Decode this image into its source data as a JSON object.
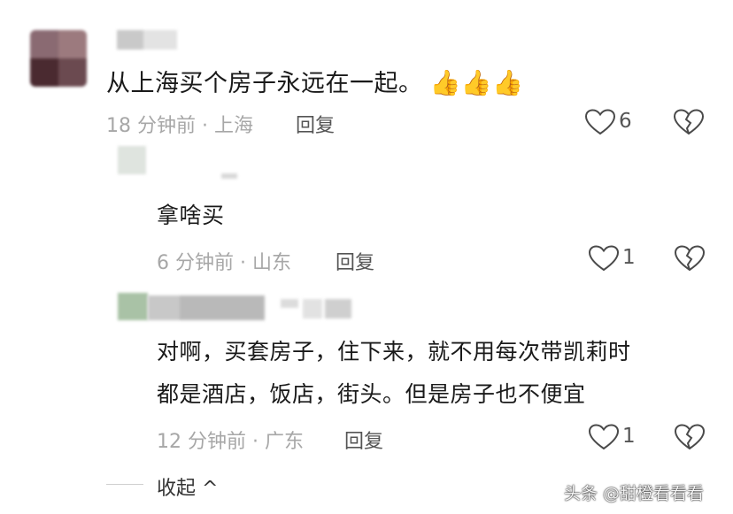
{
  "comments": [
    {
      "text": "从上海买个房子永远在一起。",
      "emoji": "👍👍👍",
      "meta": "18 分钟前 · 上海",
      "reply_label": "回复",
      "likes": "6"
    },
    {
      "text": "拿啥买",
      "meta": "6 分钟前 · 山东",
      "reply_label": "回复",
      "likes": "1"
    },
    {
      "text_line1": "对啊，买套房子，住下来，就不用每次带凯莉时",
      "text_line2": "都是酒店，饭店，街头。但是房子也不便宜",
      "meta": "12 分钟前 · 广东",
      "reply_label": "回复",
      "likes": "1"
    }
  ],
  "collapse_label": "收起 ^",
  "watermark": "头条 @甜橙看看看",
  "icons": [
    "heart-icon",
    "broken-heart-icon",
    "thumbs-up-emoji"
  ]
}
